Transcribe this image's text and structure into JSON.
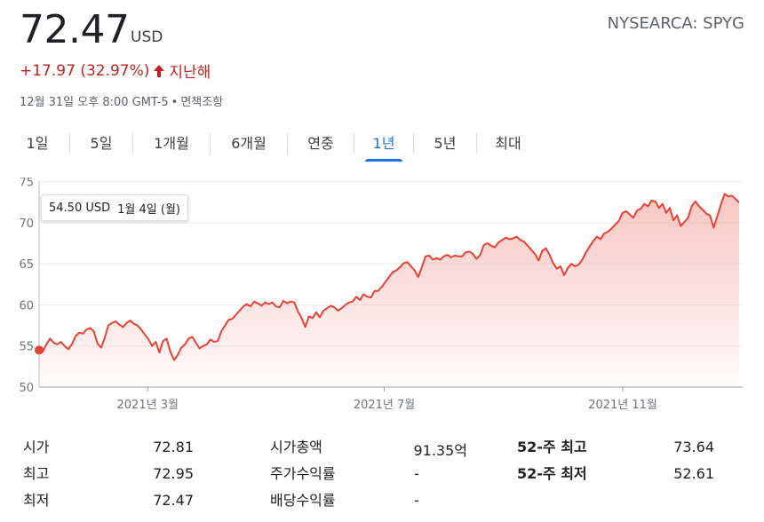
{
  "quote": {
    "price": "72.47",
    "currency": "USD",
    "exchange_ticker": "NYSEARCA: SPYG",
    "change": "+17.97 (32.97%)",
    "change_period": "지난해",
    "timestamp": "12월 31일 오후 8:00 GMT-5",
    "separator": "•",
    "disclaimer": "면책조항"
  },
  "colors": {
    "down_red": "#c5221f",
    "line_red": "#e94235",
    "accent_blue": "#1a73e8"
  },
  "tabs": [
    {
      "label": "1일"
    },
    {
      "label": "5일"
    },
    {
      "label": "1개월"
    },
    {
      "label": "6개월"
    },
    {
      "label": "연중"
    },
    {
      "label": "1년",
      "active": true
    },
    {
      "label": "5년"
    },
    {
      "label": "최대"
    }
  ],
  "tooltip": {
    "value": "54.50 USD",
    "date": "1월 4일 (월)"
  },
  "chart_data": {
    "type": "area",
    "yticks": [
      "75",
      "70",
      "65",
      "60",
      "55",
      "50"
    ],
    "ylim": [
      50,
      75.5
    ],
    "xlabels": [
      "2021년 3월",
      "2021년 7월",
      "2021년 11월"
    ],
    "x_range": [
      "2021-01-04",
      "2021-12-31"
    ],
    "x_label_dates": [
      "2021-03-01",
      "2021-07-01",
      "2021-11-01"
    ],
    "grid": true,
    "series": [
      {
        "values": [
          54.5,
          54.3,
          55.2,
          55.9,
          55.4,
          55.2,
          55.5,
          55.0,
          54.6,
          55.2,
          56.2,
          56.6,
          56.5,
          57.0,
          57.2,
          56.8,
          55.3,
          54.8,
          56.0,
          57.5,
          57.8,
          58.0,
          57.6,
          57.3,
          57.8,
          58.1,
          57.7,
          57.5,
          57.0,
          56.4,
          55.8,
          55.0,
          55.5,
          54.2,
          55.6,
          55.9,
          54.3,
          53.3,
          53.9,
          54.8,
          55.2,
          55.9,
          56.1,
          55.4,
          54.7,
          55.0,
          55.2,
          55.8,
          55.5,
          55.6,
          56.8,
          57.5,
          58.2,
          58.3,
          58.8,
          59.3,
          59.8,
          60.1,
          59.8,
          60.4,
          60.2,
          59.9,
          60.3,
          60.1,
          60.3,
          59.8,
          59.7,
          60.5,
          60.2,
          60.4,
          60.3,
          59.2,
          58.4,
          57.3,
          58.6,
          58.4,
          59.1,
          58.5,
          59.3,
          59.6,
          59.9,
          59.7,
          59.3,
          59.6,
          60.0,
          60.3,
          60.4,
          61.0,
          60.6,
          61.3,
          61.0,
          60.9,
          61.7,
          61.7,
          62.2,
          62.8,
          63.4,
          64.0,
          64.2,
          64.6,
          65.1,
          65.2,
          64.7,
          64.2,
          63.4,
          64.6,
          65.9,
          66.0,
          65.5,
          65.7,
          65.5,
          65.9,
          66.1,
          65.8,
          66.0,
          65.9,
          65.9,
          66.4,
          66.5,
          66.2,
          65.6,
          66.1,
          67.3,
          67.5,
          67.2,
          67.0,
          67.6,
          67.9,
          68.2,
          68.0,
          68.1,
          68.3,
          67.9,
          67.7,
          67.2,
          66.7,
          66.2,
          65.4,
          66.6,
          66.9,
          66.1,
          65.1,
          64.4,
          64.7,
          63.6,
          64.5,
          65.0,
          64.7,
          64.9,
          65.5,
          66.4,
          67.1,
          67.8,
          68.3,
          68.0,
          68.7,
          68.9,
          69.3,
          69.8,
          70.2,
          71.2,
          71.4,
          71.0,
          70.6,
          71.5,
          71.7,
          72.3,
          72.0,
          72.7,
          72.6,
          71.8,
          72.3,
          71.2,
          71.8,
          70.3,
          70.9,
          69.6,
          70.1,
          70.6,
          72.0,
          72.6,
          72.0,
          71.6,
          71.1,
          70.9,
          69.4,
          70.8,
          72.2,
          73.5,
          73.2,
          73.3,
          72.9,
          72.47
        ]
      }
    ]
  },
  "stats": [
    {
      "label": "시가",
      "value": "72.81"
    },
    {
      "label": "최고",
      "value": "72.95"
    },
    {
      "label": "최저",
      "value": "72.47"
    },
    {
      "label": "시가총액",
      "value": "91.35억"
    },
    {
      "label": "주가수익률",
      "value": "-"
    },
    {
      "label": "배당수익률",
      "value": "-"
    },
    {
      "label": "52-주 최고",
      "value": "73.64"
    },
    {
      "label": "52-주 최저",
      "value": "52.61"
    }
  ]
}
